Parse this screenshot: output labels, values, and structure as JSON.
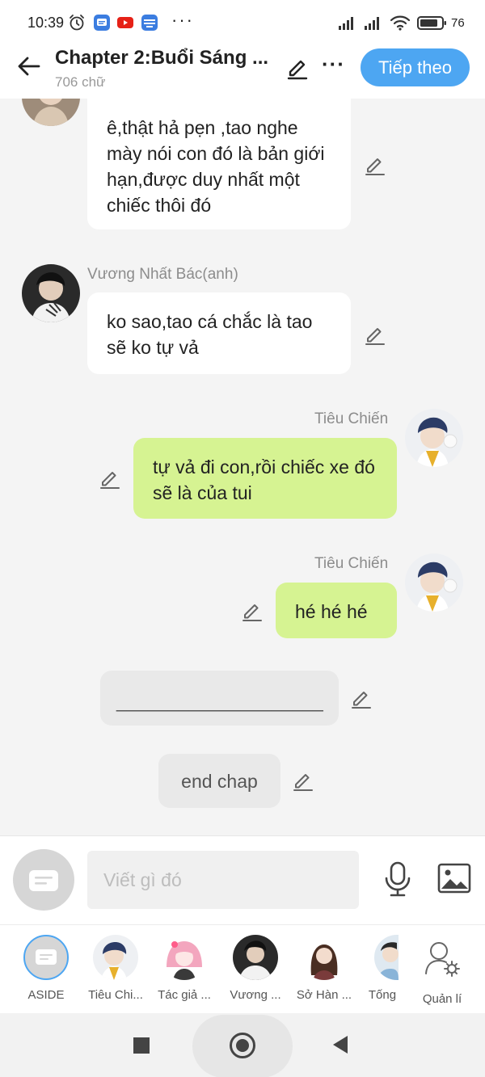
{
  "status_bar": {
    "time": "10:39",
    "battery": "76",
    "icons": [
      "alarm-icon",
      "messages-icon",
      "youtube-icon",
      "noveltoon-icon",
      "more-dots-icon",
      "signal-icon",
      "signal-icon",
      "wifi-icon",
      "battery-icon"
    ]
  },
  "header": {
    "title": "Chapter 2:Buổi Sáng ...",
    "word_count": "706 chữ",
    "next_label": "Tiếp theo"
  },
  "messages": [
    {
      "text": "ê,thật hả pẹn ,tao nghe mày nói con đó là bản giới hạn,được duy nhất một chiếc thôi đó",
      "side": "left",
      "sender": ""
    },
    {
      "sender": "Vương Nhất Bác(anh)",
      "text": "ko sao,tao cá chắc là tao sẽ ko tự vả",
      "side": "left"
    },
    {
      "sender": "Tiêu Chiến",
      "text": "tự vả đi con,rồi chiếc xe đó sẽ là của tui",
      "side": "right"
    },
    {
      "sender": "Tiêu Chiến",
      "text": "hé hé hé",
      "side": "right"
    },
    {
      "text": "____________________",
      "side": "aside"
    },
    {
      "text": "end chap",
      "side": "aside"
    }
  ],
  "input": {
    "placeholder": "Viết gì đó"
  },
  "characters": [
    {
      "label": "ASIDE"
    },
    {
      "label": "Tiêu Chi..."
    },
    {
      "label": "Tác giả ..."
    },
    {
      "label": "Vương ..."
    },
    {
      "label": "Sở Hàn ..."
    },
    {
      "label": "Tống"
    },
    {
      "label": "Quản lí"
    }
  ],
  "colors": {
    "accent": "#4da6f2",
    "bubble_right": "#d6f392",
    "bubble_left": "#ffffff",
    "bubble_aside": "#e9e9e9"
  }
}
